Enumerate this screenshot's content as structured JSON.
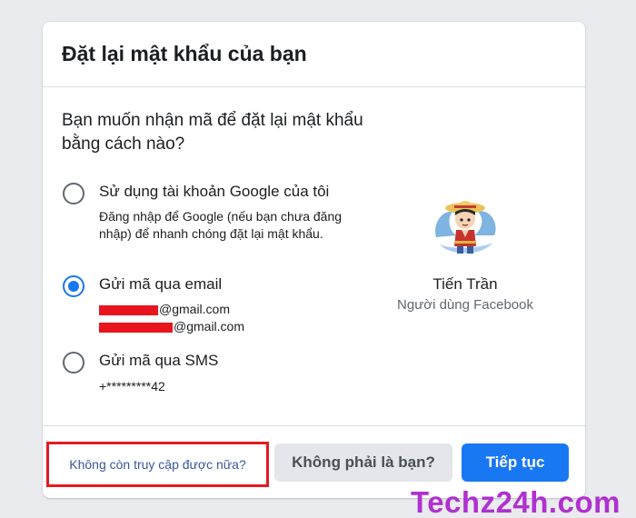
{
  "header": {
    "title": "Đặt lại mật khẩu của bạn"
  },
  "question": "Bạn muốn nhận mã để đặt lại mật khẩu bằng cách nào?",
  "options": [
    {
      "label": "Sử dụng tài khoản Google của tôi",
      "description": "Đăng nhập để Google (nếu bạn chưa đăng nhập) để nhanh chóng đặt lại mật khẩu.",
      "selected": false
    },
    {
      "label": "Gửi mã qua email",
      "emails": [
        "@gmail.com",
        "@gmail.com"
      ],
      "selected": true
    },
    {
      "label": "Gửi mã qua SMS",
      "phone": "+*********42",
      "selected": false
    }
  ],
  "profile": {
    "name": "Tiến Trần",
    "subtitle": "Người dùng Facebook"
  },
  "footer": {
    "help_link": "Không còn truy cập được nữa?",
    "not_you_button": "Không phải là bạn?",
    "continue_button": "Tiếp tục"
  },
  "watermark": "Techz24h.com",
  "colors": {
    "accent": "#1877f2",
    "highlight_box": "#e31b23",
    "redaction": "#e8141e",
    "watermark": "#b030d0"
  }
}
